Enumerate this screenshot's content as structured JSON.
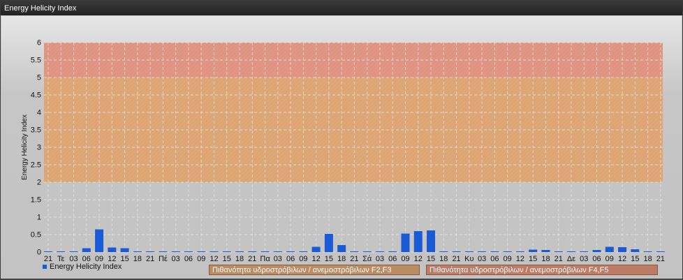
{
  "window": {
    "title": "Energy Helicity Index"
  },
  "legend": {
    "series_label": "Energy Helicity Index"
  },
  "bands": [
    {
      "label": "Πιθανότητα υδροστρόβιλων / ανεμοστρόβιλων F2,F3",
      "from": 2,
      "to": 5,
      "color": "#e0a068"
    },
    {
      "label": "Πιθανότητα υδροστρόβιλων / ανεμοστρόβιλων F4,F5",
      "from": 5,
      "to": 6,
      "color": "#e38c78"
    }
  ],
  "colors": {
    "bar": "#1a5ad6",
    "plot_background": "#c4c4c4",
    "grid": "#e6e6e6"
  },
  "chart_data": {
    "type": "bar",
    "title": "",
    "xlabel": "",
    "ylabel": "Energy Helicity Index",
    "ylim": [
      0,
      6
    ],
    "yticks": [
      "0",
      "0.5",
      "1",
      "1.5",
      "2",
      "2.5",
      "3",
      "3.5",
      "4",
      "4.5",
      "5",
      "5.5",
      "6"
    ],
    "categories": [
      "21",
      "Τε",
      "03",
      "06",
      "09",
      "12",
      "15",
      "18",
      "21",
      "Πέ",
      "03",
      "06",
      "09",
      "12",
      "15",
      "18",
      "21",
      "Πα",
      "03",
      "06",
      "09",
      "12",
      "15",
      "18",
      "21",
      "Σά",
      "03",
      "06",
      "09",
      "12",
      "15",
      "18",
      "21",
      "Κυ",
      "03",
      "06",
      "09",
      "12",
      "15",
      "18",
      "21",
      "Δε",
      "03",
      "06",
      "09",
      "12",
      "15",
      "18",
      "21"
    ],
    "series": [
      {
        "name": "Energy Helicity Index",
        "values": [
          0.02,
          0.02,
          0.02,
          0.11,
          0.65,
          0.13,
          0.11,
          0.02,
          0.02,
          0.02,
          0.02,
          0.02,
          0.02,
          0.02,
          0.02,
          0.02,
          0.02,
          0.02,
          0.02,
          0.02,
          0.02,
          0.15,
          0.52,
          0.2,
          0.02,
          0.02,
          0.02,
          0.02,
          0.53,
          0.6,
          0.62,
          0.02,
          0.02,
          0.02,
          0.02,
          0.02,
          0.02,
          0.02,
          0.07,
          0.06,
          0.02,
          0.02,
          0.02,
          0.06,
          0.15,
          0.14,
          0.08,
          0.02,
          0.02
        ]
      }
    ],
    "grid": true,
    "legend_position": "bottom-left"
  }
}
